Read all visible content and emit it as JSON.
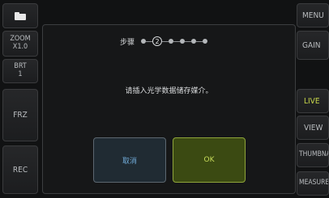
{
  "left_panel": {
    "folder_icon": "folder-icon",
    "zoom_label": "ZOOM",
    "zoom_value": "X1.0",
    "brt_label": "BRT",
    "brt_value": "1",
    "frz_label": "FRZ",
    "rec_label": "REC"
  },
  "right_panel": {
    "menu_label": "MENU",
    "gain_label": "GAIN",
    "live_label": "LIVE",
    "view_label": "VIEW",
    "thumbnail_label": "THUMBNAIL",
    "measure_label": "MEASURE"
  },
  "dialog": {
    "step_label": "步骤",
    "current_step": "2",
    "message": "请插入光学数据储存媒介。",
    "cancel_label": "取消",
    "ok_label": "OK"
  },
  "colors": {
    "accent_live": "#c9d84a",
    "ok_bg": "#3b4a12",
    "cancel_text": "#6fa9d6"
  }
}
